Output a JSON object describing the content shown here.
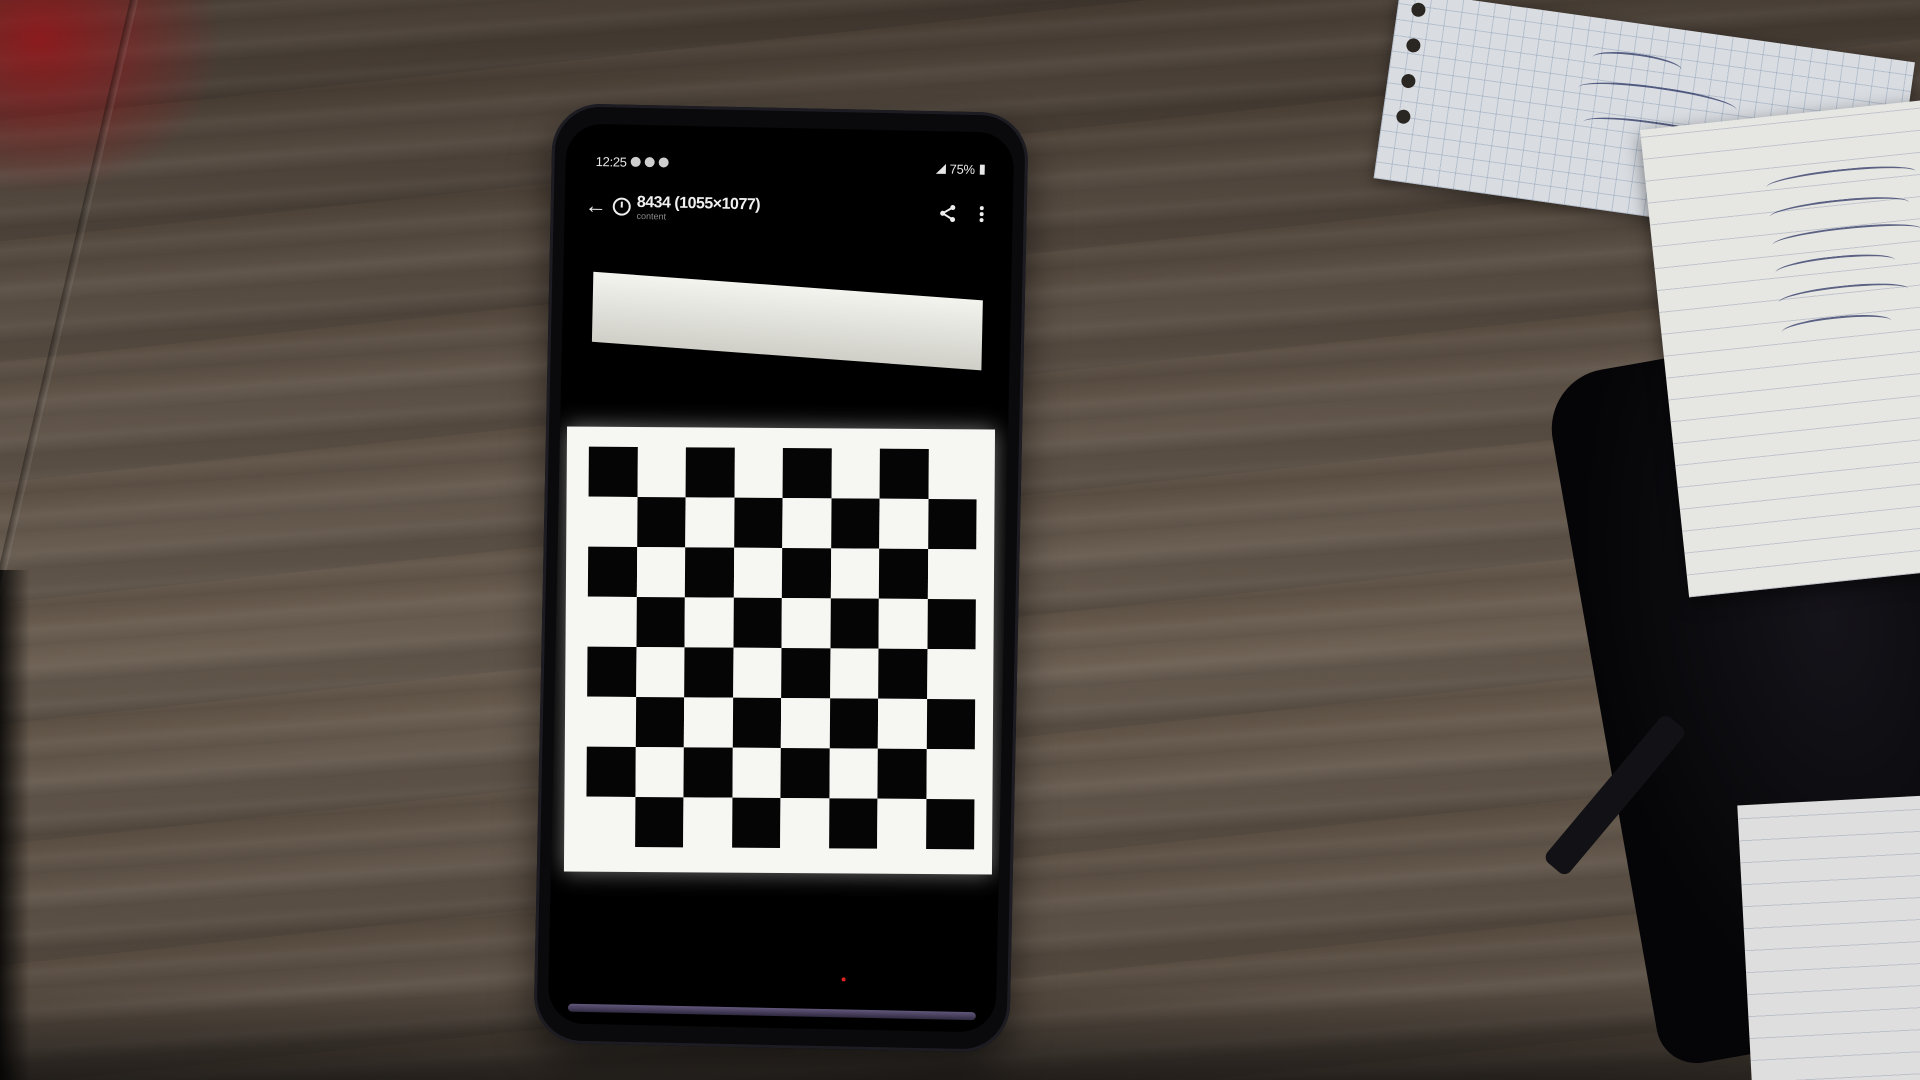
{
  "scene": {
    "description_colors": {
      "desk": "#5b5046",
      "phone_body": "#0a0a0d",
      "screen_bg": "#000000"
    }
  },
  "phone_screen": {
    "status_bar": {
      "time": "12:25",
      "battery": "75%"
    },
    "app_bar": {
      "back_icon": "arrow-left-icon",
      "title": "8434 (1055×1077)",
      "subtitle": "content",
      "share_icon": "share-icon",
      "menu_icon": "more-vert-icon"
    },
    "image": {
      "pattern": "checkerboard",
      "rows": 8,
      "cols": 8,
      "square_colors": [
        "#050505",
        "#f6f6f2"
      ]
    }
  }
}
